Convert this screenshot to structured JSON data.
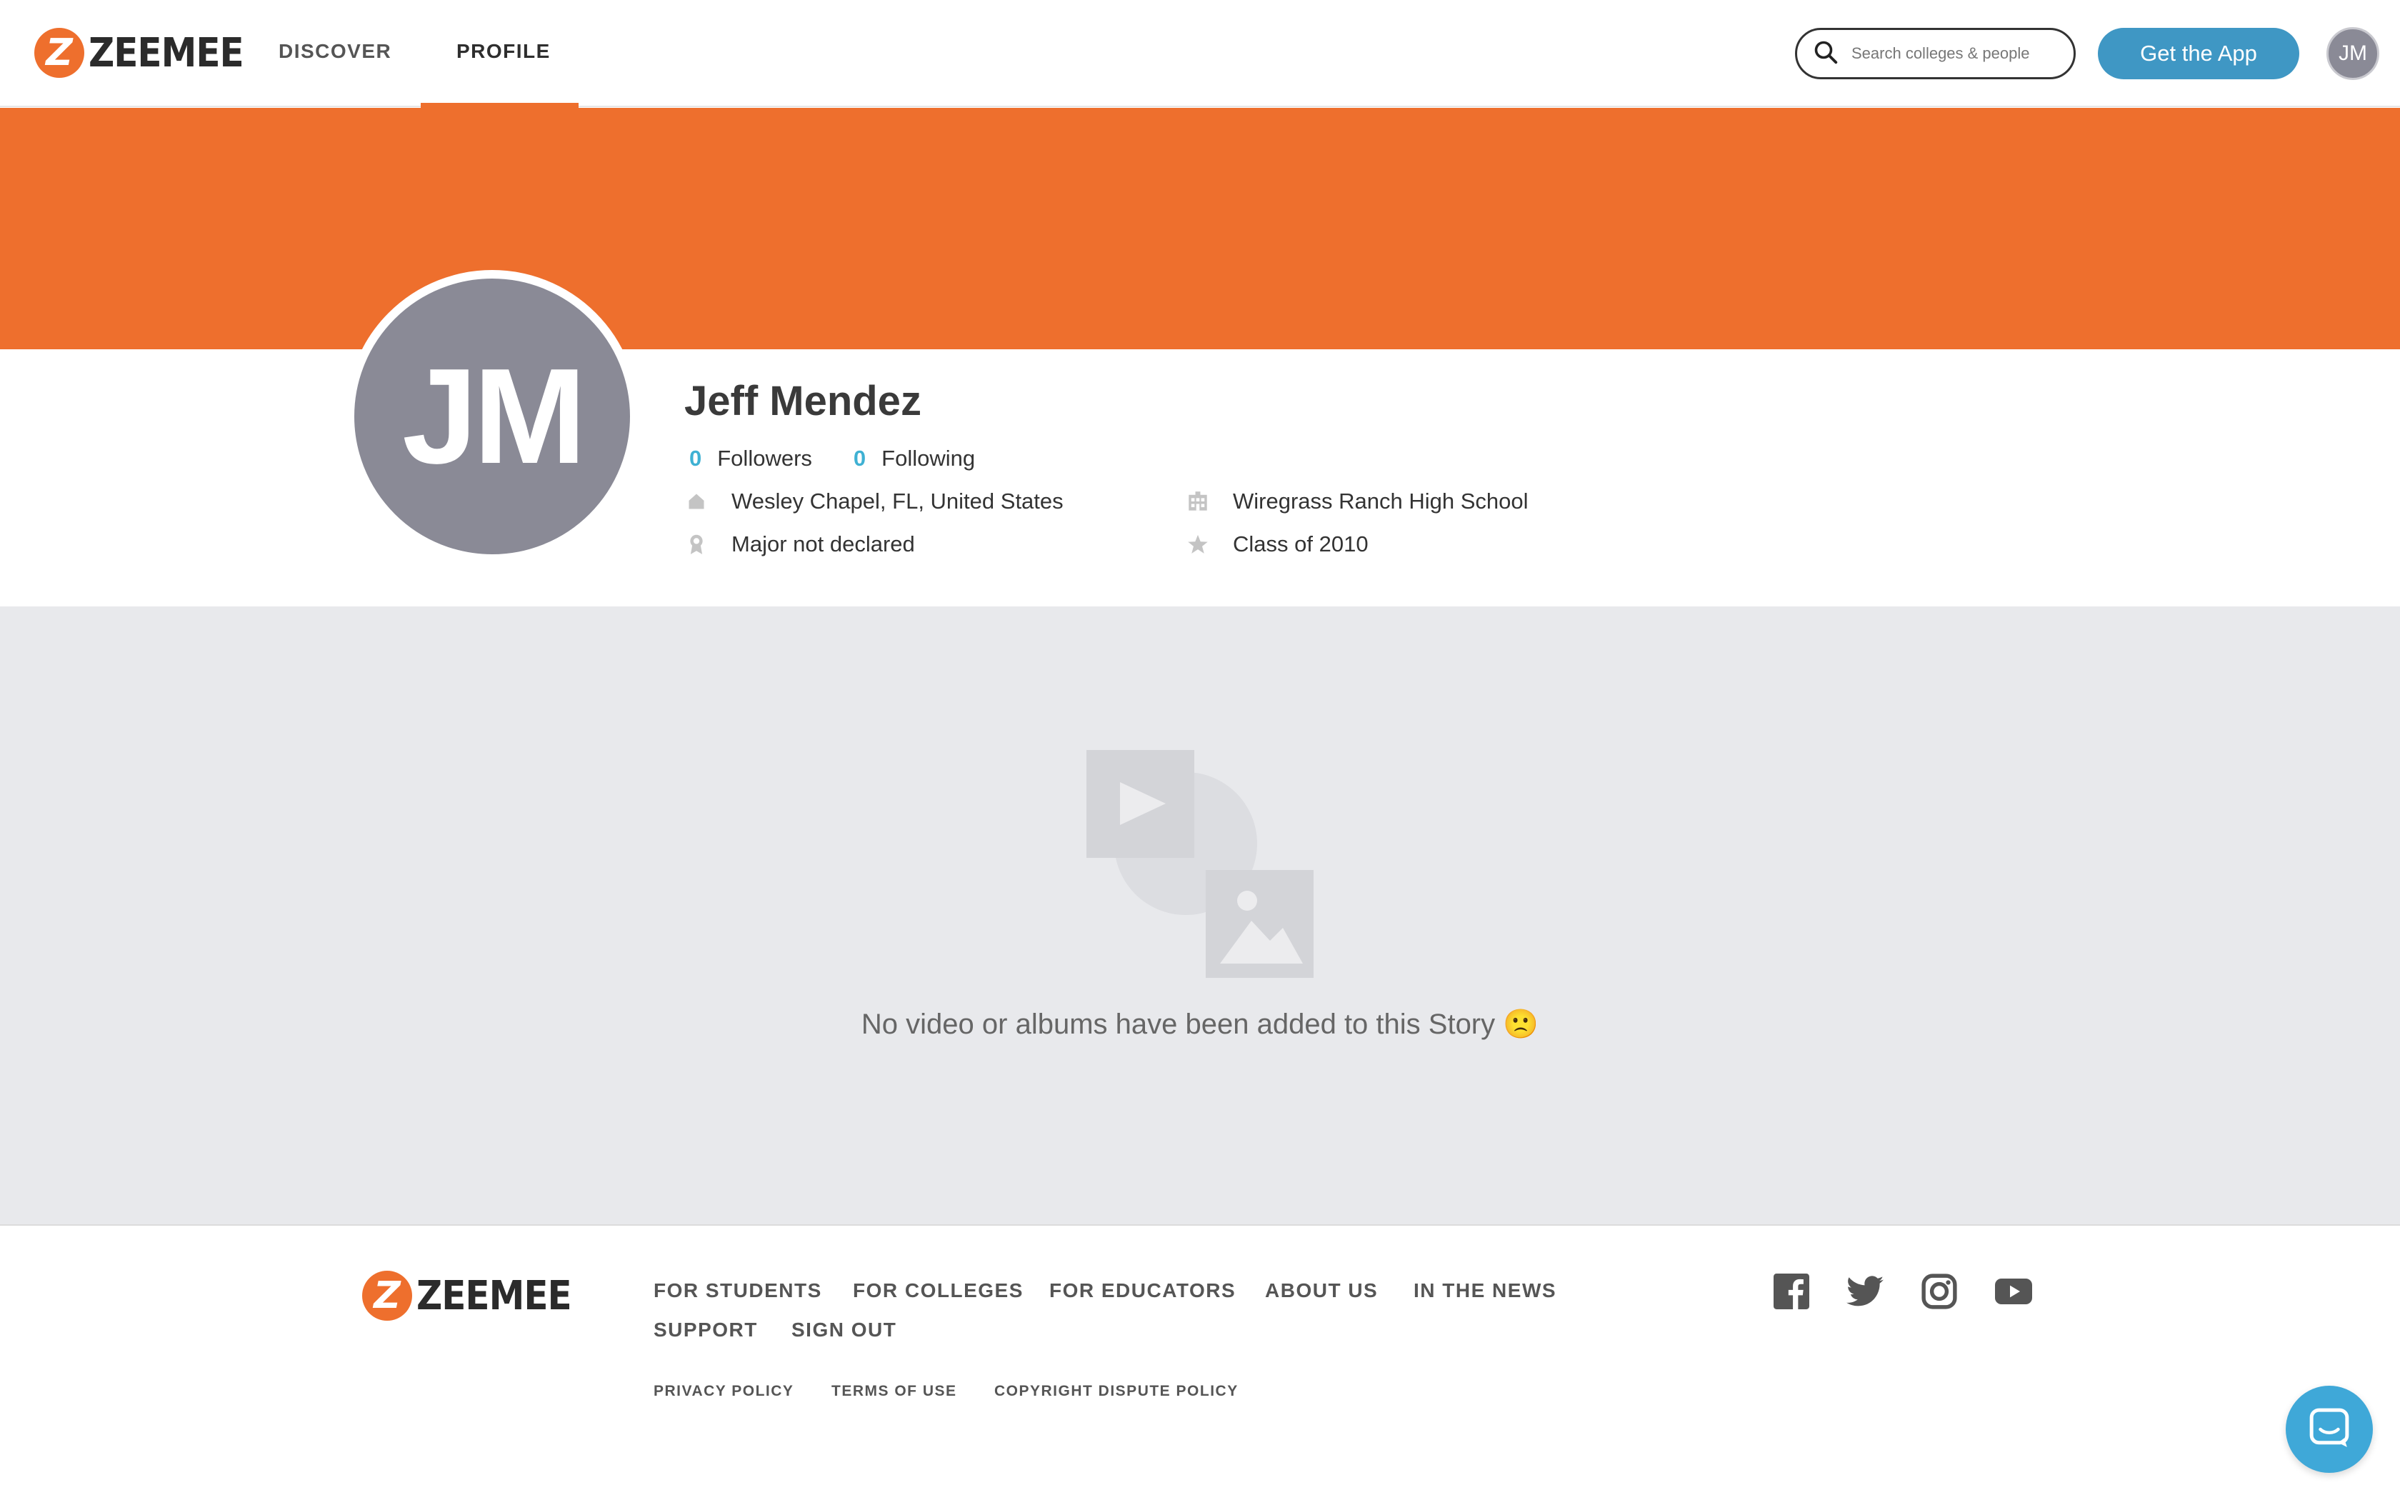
{
  "brand": {
    "logo_letter": "Z",
    "logo_word": "ZEEMEE",
    "accent_color": "#ee6f2d"
  },
  "nav": {
    "links": [
      {
        "label": "DISCOVER",
        "active": false
      },
      {
        "label": "PROFILE",
        "active": true
      }
    ],
    "search_placeholder": "Search colleges & people",
    "get_app_label": "Get the App",
    "avatar_initials": "JM"
  },
  "profile": {
    "initials": "JM",
    "name": "Jeff Mendez",
    "followers_count": "0",
    "followers_label": "Followers",
    "following_count": "0",
    "following_label": "Following",
    "location": "Wesley Chapel, FL, United States",
    "major": "Major not declared",
    "school": "Wiregrass Ranch High School",
    "class_year": "Class of 2010"
  },
  "story": {
    "empty_message": "No video or albums have been added to this Story",
    "empty_emoji": "🙁"
  },
  "footer": {
    "links_row1": [
      "FOR STUDENTS",
      "FOR COLLEGES",
      "FOR EDUCATORS",
      "ABOUT US",
      "IN THE NEWS"
    ],
    "links_row2": [
      "SUPPORT",
      "SIGN OUT"
    ],
    "legal": [
      "PRIVACY POLICY",
      "TERMS OF USE",
      "COPYRIGHT DISPUTE POLICY"
    ],
    "social_icons": [
      "facebook-icon",
      "twitter-icon",
      "instagram-icon",
      "youtube-icon"
    ]
  },
  "colors": {
    "banner": "#ee6f2d",
    "primary_button": "#3f97c4",
    "count_highlight": "#3fb1d3",
    "avatar_gray": "#8a8a96"
  }
}
